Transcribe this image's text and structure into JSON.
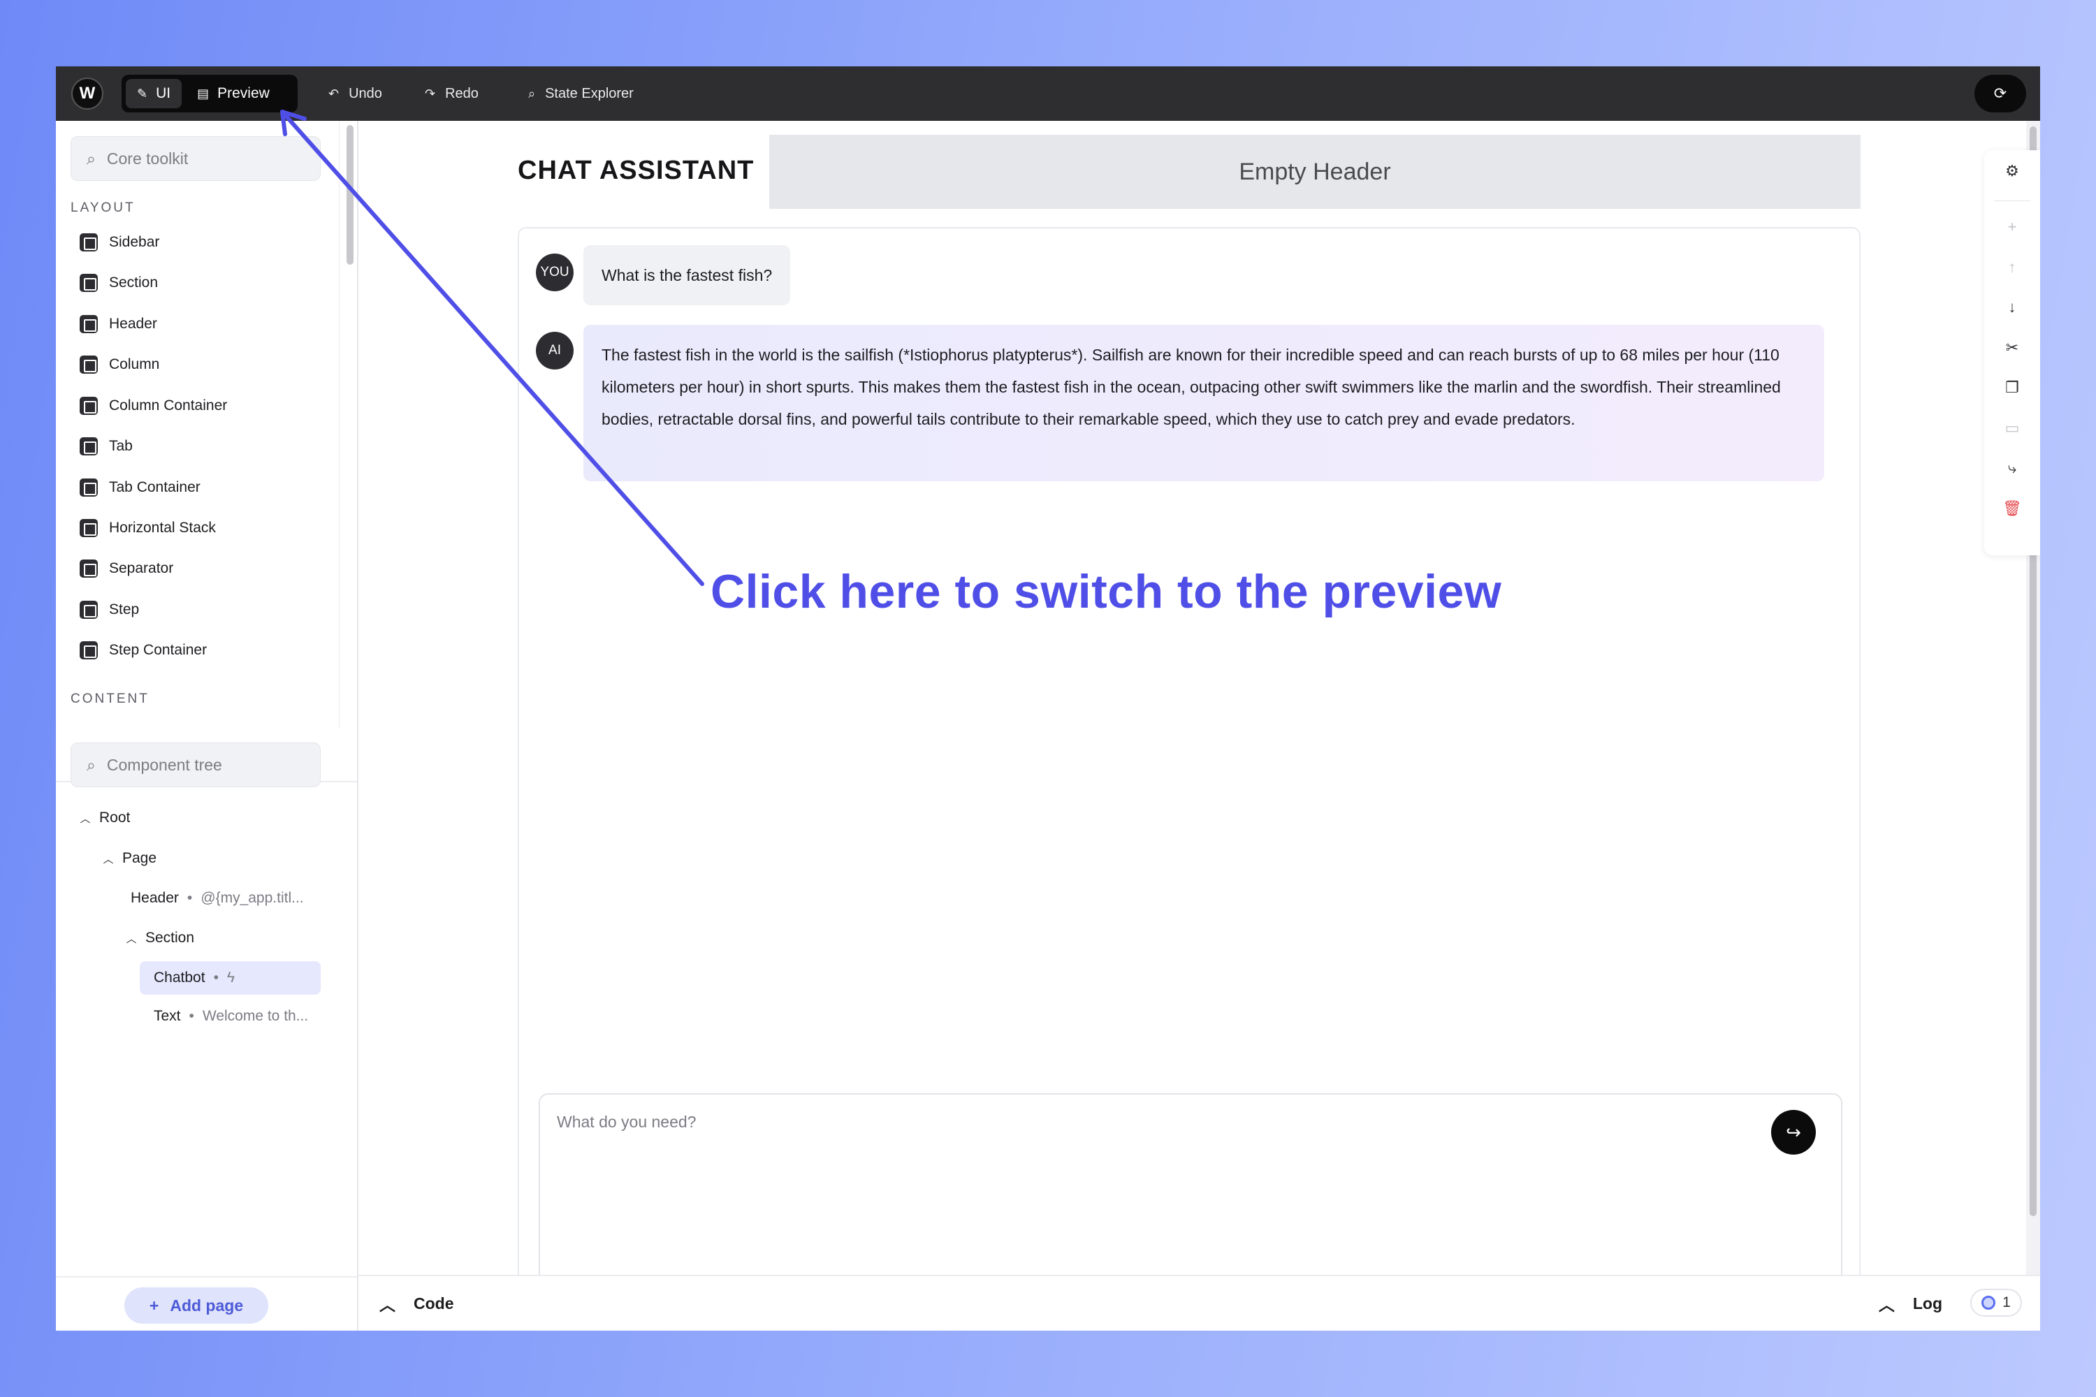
{
  "topbar": {
    "logo": "W",
    "modes": [
      {
        "label": "UI",
        "icon": "pencil-icon",
        "active": true
      },
      {
        "label": "Preview",
        "icon": "preview-icon",
        "active": false
      }
    ],
    "undo_label": "Undo",
    "redo_label": "Redo",
    "state_explorer_label": "State Explorer"
  },
  "toolkit": {
    "search_placeholder": "Core toolkit",
    "layout_label": "LAYOUT",
    "layout_items": [
      "Sidebar",
      "Section",
      "Header",
      "Column",
      "Column Container",
      "Tab",
      "Tab Container",
      "Horizontal Stack",
      "Separator",
      "Step",
      "Step Container"
    ],
    "content_label": "CONTENT"
  },
  "tree": {
    "search_placeholder": "Component tree",
    "root": "Root",
    "page": "Page",
    "header": "Header",
    "header_value": "@{my_app.titl...",
    "section": "Section",
    "chatbot": "Chatbot",
    "text": "Text",
    "text_value": "Welcome to th..."
  },
  "add_page_label": "Add page",
  "canvas": {
    "title": "CHAT ASSISTANT",
    "empty_header": "Empty Header",
    "messages": [
      {
        "role": "YOU",
        "text": "What is the fastest fish?"
      },
      {
        "role": "AI",
        "text": "The fastest fish in the world is the sailfish (*Istiophorus platypterus*). Sailfish are known for their incredible speed and can reach bursts of up to 68 miles per hour (110 kilometers per hour) in short spurts. This makes them the fastest fish in the ocean, outpacing other swift swimmers like the marlin and the swordfish. Their streamlined bodies, retractable dorsal fins, and powerful tails contribute to their remarkable speed, which they use to catch prey and evade predators."
      }
    ],
    "input_placeholder": "What do you need?"
  },
  "bottom": {
    "code_label": "Code",
    "log_label": "Log",
    "log_count": "1"
  },
  "annotation": {
    "text": "Click here to switch to the preview",
    "color": "#4f4fe8"
  },
  "colors": {
    "topbar": "#2e2e30",
    "accent": "#4d5bd8",
    "selected_bg": "#e6e8fd"
  }
}
